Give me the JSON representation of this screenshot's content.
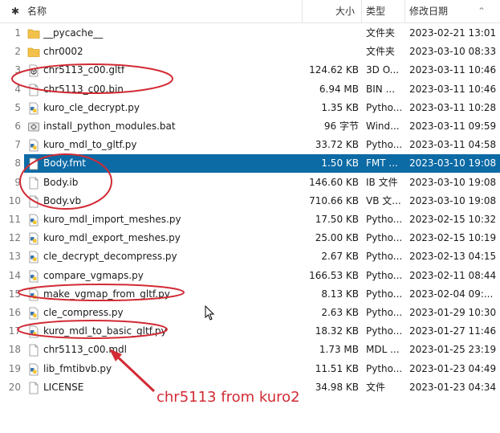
{
  "header": {
    "name": "名称",
    "size": "大小",
    "type": "类型",
    "date": "修改日期"
  },
  "rows": [
    {
      "num": "1",
      "icon": "folder-icon",
      "name": "__pycache__",
      "size": "",
      "type": "文件夹",
      "date": "2023-02-21 13:01"
    },
    {
      "num": "2",
      "icon": "folder-icon",
      "name": "chr0002",
      "size": "",
      "type": "文件夹",
      "date": "2023-03-10 08:33"
    },
    {
      "num": "3",
      "icon": "3d-object-icon",
      "name": "chr5113_c00.gltf",
      "size": "124.62 KB",
      "type": "3D O...",
      "date": "2023-03-11 10:46"
    },
    {
      "num": "4",
      "icon": "file-icon",
      "name": "chr5113_c00.bin",
      "size": "6.94 MB",
      "type": "BIN ...",
      "date": "2023-03-11 10:46"
    },
    {
      "num": "5",
      "icon": "python-file-icon",
      "name": "kuro_cle_decrypt.py",
      "size": "1.35 KB",
      "type": "Pytho...",
      "date": "2023-03-11 10:28"
    },
    {
      "num": "6",
      "icon": "batch-file-icon",
      "name": "install_python_modules.bat",
      "size": "96 字节",
      "type": "Wind...",
      "date": "2023-03-11 09:59"
    },
    {
      "num": "7",
      "icon": "python-file-icon",
      "name": "kuro_mdl_to_gltf.py",
      "size": "33.72 KB",
      "type": "Pytho...",
      "date": "2023-03-11 04:58"
    },
    {
      "num": "8",
      "icon": "file-icon",
      "name": "Body.fmt",
      "size": "1.50 KB",
      "type": "FMT ...",
      "date": "2023-03-10 19:08",
      "selected": true
    },
    {
      "num": "9",
      "icon": "file-icon",
      "name": "Body.ib",
      "size": "146.60 KB",
      "type": "IB 文件",
      "date": "2023-03-10 19:08"
    },
    {
      "num": "10",
      "icon": "file-icon",
      "name": "Body.vb",
      "size": "710.66 KB",
      "type": "VB 文...",
      "date": "2023-03-10 19:08"
    },
    {
      "num": "11",
      "icon": "python-file-icon",
      "name": "kuro_mdl_import_meshes.py",
      "size": "17.50 KB",
      "type": "Pytho...",
      "date": "2023-02-15 10:32"
    },
    {
      "num": "12",
      "icon": "python-file-icon",
      "name": "kuro_mdl_export_meshes.py",
      "size": "25.00 KB",
      "type": "Pytho...",
      "date": "2023-02-15 10:19"
    },
    {
      "num": "13",
      "icon": "python-file-icon",
      "name": "cle_decrypt_decompress.py",
      "size": "2.67 KB",
      "type": "Pytho...",
      "date": "2023-02-13 04:15"
    },
    {
      "num": "14",
      "icon": "python-file-icon",
      "name": "compare_vgmaps.py",
      "size": "166.53 KB",
      "type": "Pytho...",
      "date": "2023-02-11 08:44"
    },
    {
      "num": "15",
      "icon": "python-file-icon",
      "name": "make_vgmap_from_gltf.py",
      "size": "8.13 KB",
      "type": "Pytho...",
      "date": "2023-02-04 09:..."
    },
    {
      "num": "16",
      "icon": "python-file-icon",
      "name": "cle_compress.py",
      "size": "2.63 KB",
      "type": "Pytho...",
      "date": "2023-01-29 10:30"
    },
    {
      "num": "17",
      "icon": "python-file-icon",
      "name": "kuro_mdl_to_basic_gltf.py",
      "size": "18.32 KB",
      "type": "Pytho...",
      "date": "2023-01-27 11:46"
    },
    {
      "num": "18",
      "icon": "file-icon",
      "name": "chr5113_c00.mdl",
      "size": "1.73 MB",
      "type": "MDL ...",
      "date": "2023-01-25 23:19"
    },
    {
      "num": "19",
      "icon": "python-file-icon",
      "name": "lib_fmtibvb.py",
      "size": "11.51 KB",
      "type": "Pytho...",
      "date": "2023-01-23 04:49"
    },
    {
      "num": "20",
      "icon": "file-icon",
      "name": "LICENSE",
      "size": "34.98 KB",
      "type": "文件",
      "date": "2023-01-23 04:34"
    }
  ],
  "annotation": {
    "text": "chr5113 from kuro2",
    "color": "#d22b35"
  },
  "colors": {
    "selection": "#0c6aa5"
  }
}
